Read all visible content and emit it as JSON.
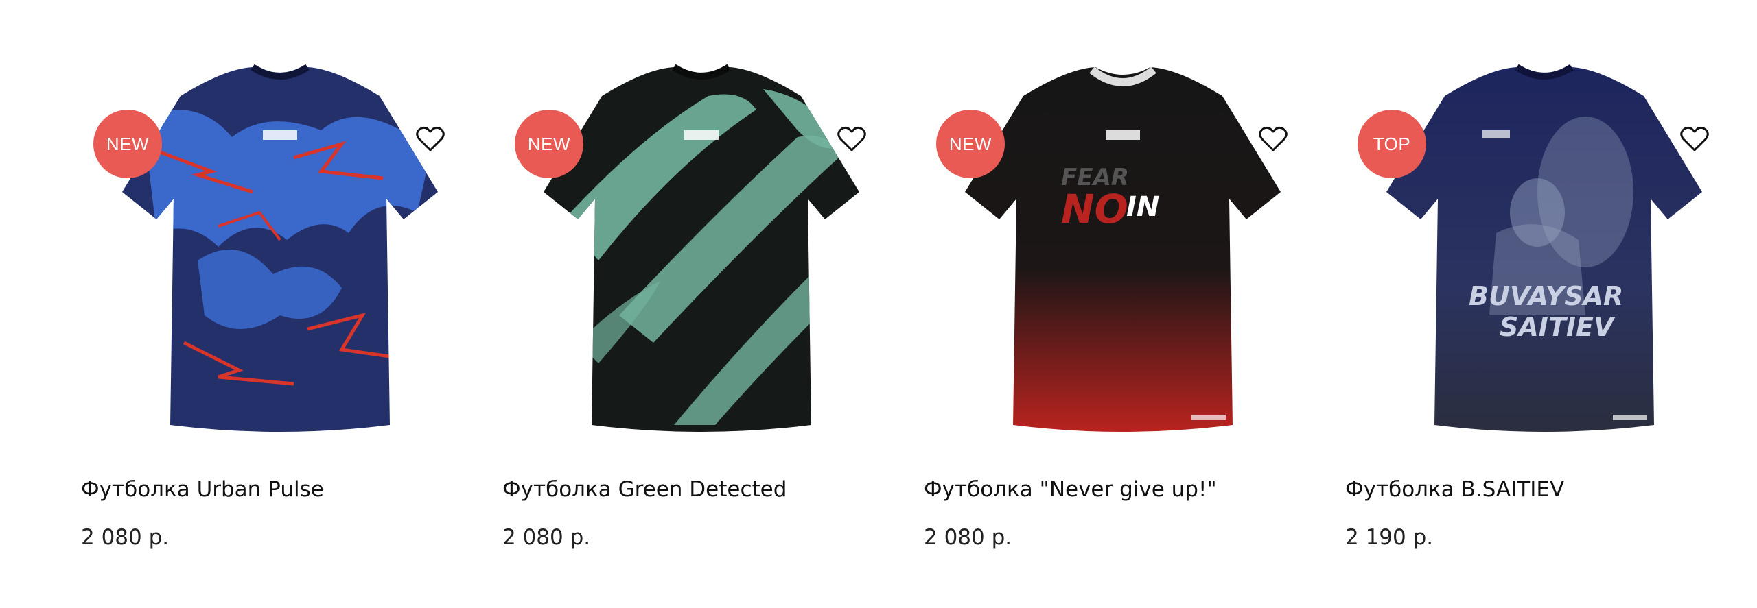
{
  "products": [
    {
      "badge": "NEW",
      "title": "Футболка Urban Pulse",
      "price": "2 080 р.",
      "colors": {
        "main": "#23306a",
        "accent": "#3d6fd6",
        "splash": "#d8342a"
      }
    },
    {
      "badge": "NEW",
      "title": "Футболка Green Detected",
      "price": "2 080 р.",
      "colors": {
        "main": "#151918",
        "accent": "#72b49d"
      }
    },
    {
      "badge": "NEW",
      "title": "Футболка \"Never give up!\"",
      "price": "2 080 р.",
      "colors": {
        "main": "#161616",
        "accent": "#b9231f"
      }
    },
    {
      "badge": "TOP",
      "title": "Футболка B.SAITIEV",
      "price": "2 190 р.",
      "colors": {
        "main": "#1d255e",
        "accent": "#9aa6c4"
      }
    }
  ],
  "icons": {
    "favorite": "heart-outline-icon"
  },
  "badge_color": "#ea5a55"
}
